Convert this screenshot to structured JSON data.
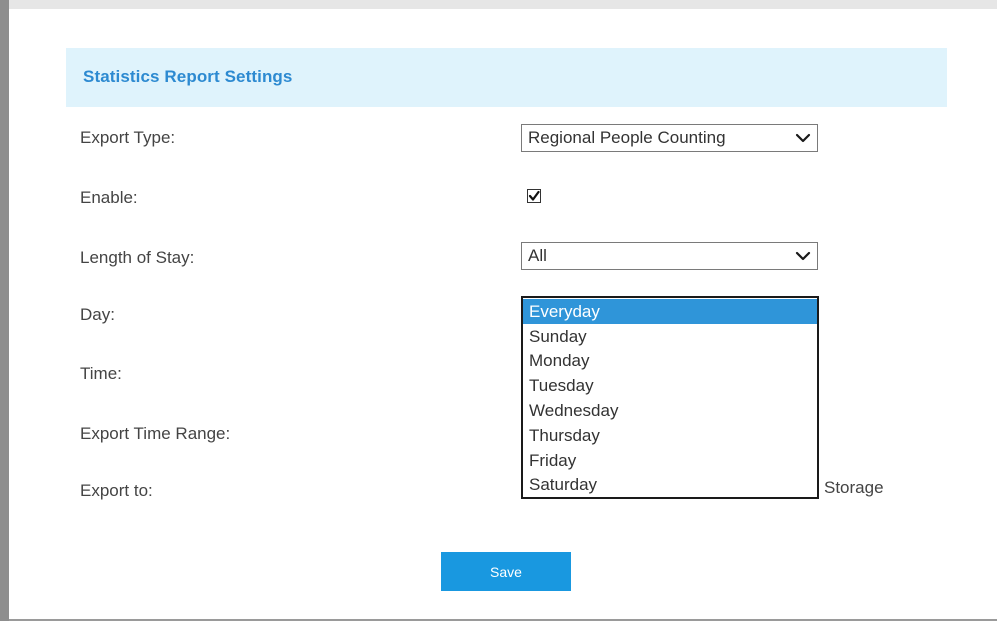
{
  "section": {
    "title": "Statistics Report Settings"
  },
  "form": {
    "export_type": {
      "label": "Export Type:",
      "value": "Regional People Counting"
    },
    "enable": {
      "label": "Enable:",
      "checked": true
    },
    "length_of_stay": {
      "label": "Length of Stay:",
      "value": "All"
    },
    "day": {
      "label": "Day:",
      "options": [
        "Everyday",
        "Sunday",
        "Monday",
        "Tuesday",
        "Wednesday",
        "Thursday",
        "Friday",
        "Saturday"
      ],
      "selected": "Everyday"
    },
    "time": {
      "label": "Time:"
    },
    "export_time_range": {
      "label": "Export Time Range:"
    },
    "export_to": {
      "label": "Export to:",
      "partial_value": "Storage"
    }
  },
  "actions": {
    "save_label": "Save"
  },
  "colors": {
    "header_bg": "#dff3fc",
    "header_text": "#2d8ad1",
    "selected_option_bg": "#2f95d9",
    "save_button_bg": "#1998e0"
  }
}
